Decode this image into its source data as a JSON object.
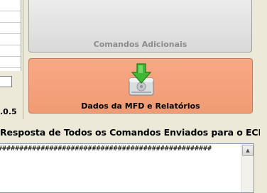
{
  "buttons": {
    "comandos_adicionais": "Comandos Adicionais",
    "dados_mfd": "Dados da MFD e Relatórios"
  },
  "version_fragment": ".0.5",
  "response": {
    "title": "Resposta de Todos os Comandos Enviados para o ECF",
    "text": "##################################################"
  },
  "icons": {
    "mfd_icon": "disk-download-icon",
    "scroll_up": "scroll-up-arrow-icon"
  }
}
